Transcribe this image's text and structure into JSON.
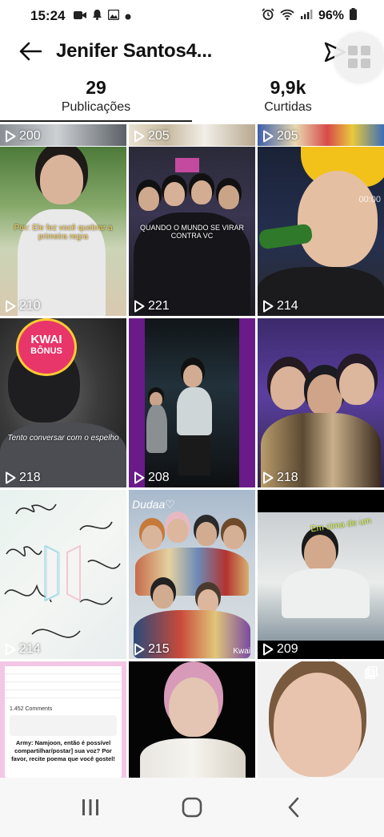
{
  "status_bar": {
    "time": "15:24",
    "left_icons": [
      "video-icon",
      "bell-icon",
      "image-icon",
      "dot-icon"
    ],
    "right_icons": [
      "alarm-icon",
      "wifi-icon",
      "signal-icon"
    ],
    "battery": "96%"
  },
  "header": {
    "title": "Jenifer Santos4..."
  },
  "stats": {
    "posts_count": "29",
    "posts_label": "Publicações",
    "likes_count": "9,9k",
    "likes_label": "Curtidas"
  },
  "grid": {
    "row0": [
      "200",
      "205",
      "205"
    ],
    "row1": [
      "210",
      "221",
      "214"
    ],
    "row2": [
      "218",
      "208",
      "218"
    ],
    "row3": [
      "214",
      "215",
      "209"
    ],
    "captions": {
      "r1c0": "Pov: Ele fez você quebrar a primeira regra",
      "r1c1": "QUANDO O MUNDO SE VIRAR CONTRA VC",
      "r1c2_timer": "00:00",
      "r2c0_badge_line1": "KWAI",
      "r2c0_badge_line2": "BÔNUS",
      "r2c0_text": "Tento conversar com o espelho",
      "r3c1_text": "Dudaa♡",
      "r3c1_wm": "Kwai",
      "r3c2_text": "Em cima de um",
      "r4c0_line1": "1.452 Comments",
      "r4c0_line2": "Army: Namjoon, então é possível compartilhar/postar] sua voz? Por favor, recite poema que você gostel!"
    }
  },
  "navbar": {
    "icons": [
      "recents-icon",
      "home-icon",
      "back-icon"
    ]
  }
}
